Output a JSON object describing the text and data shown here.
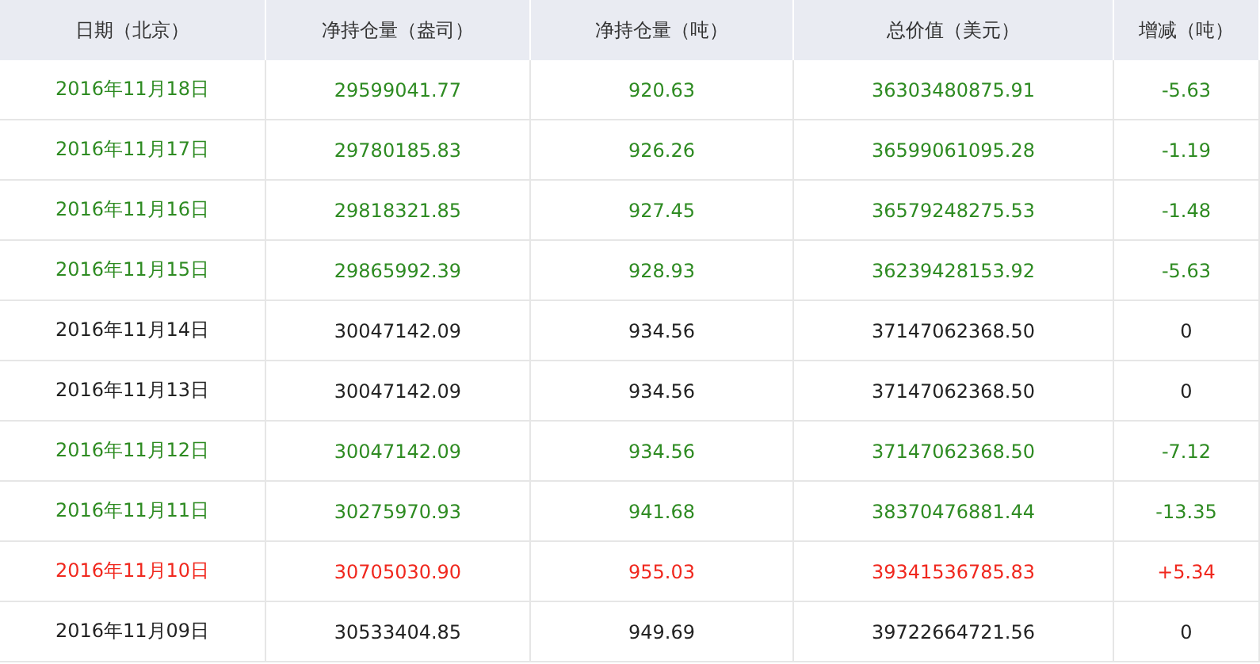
{
  "table": {
    "columns": [
      "日期（北京）",
      "净持仓量（盎司）",
      "净持仓量（吨）",
      "总价值（美元）",
      "增减（吨）"
    ],
    "rows": [
      {
        "color": "#2e8b22",
        "cells": [
          "2016年11月18日",
          "29599041.77",
          "920.63",
          "36303480875.91",
          "-5.63"
        ]
      },
      {
        "color": "#2e8b22",
        "cells": [
          "2016年11月17日",
          "29780185.83",
          "926.26",
          "36599061095.28",
          "-1.19"
        ]
      },
      {
        "color": "#2e8b22",
        "cells": [
          "2016年11月16日",
          "29818321.85",
          "927.45",
          "36579248275.53",
          "-1.48"
        ]
      },
      {
        "color": "#2e8b22",
        "cells": [
          "2016年11月15日",
          "29865992.39",
          "928.93",
          "36239428153.92",
          "-5.63"
        ]
      },
      {
        "color": "#222222",
        "cells": [
          "2016年11月14日",
          "30047142.09",
          "934.56",
          "37147062368.50",
          "0"
        ]
      },
      {
        "color": "#222222",
        "cells": [
          "2016年11月13日",
          "30047142.09",
          "934.56",
          "37147062368.50",
          "0"
        ]
      },
      {
        "color": "#2e8b22",
        "cells": [
          "2016年11月12日",
          "30047142.09",
          "934.56",
          "37147062368.50",
          "-7.12"
        ]
      },
      {
        "color": "#2e8b22",
        "cells": [
          "2016年11月11日",
          "30275970.93",
          "941.68",
          "38370476881.44",
          "-13.35"
        ]
      },
      {
        "color": "#f0281e",
        "cells": [
          "2016年11月10日",
          "30705030.90",
          "955.03",
          "39341536785.83",
          "+5.34"
        ]
      },
      {
        "color": "#222222",
        "cells": [
          "2016年11月09日",
          "30533404.85",
          "949.69",
          "39722664721.56",
          "0"
        ]
      }
    ]
  }
}
